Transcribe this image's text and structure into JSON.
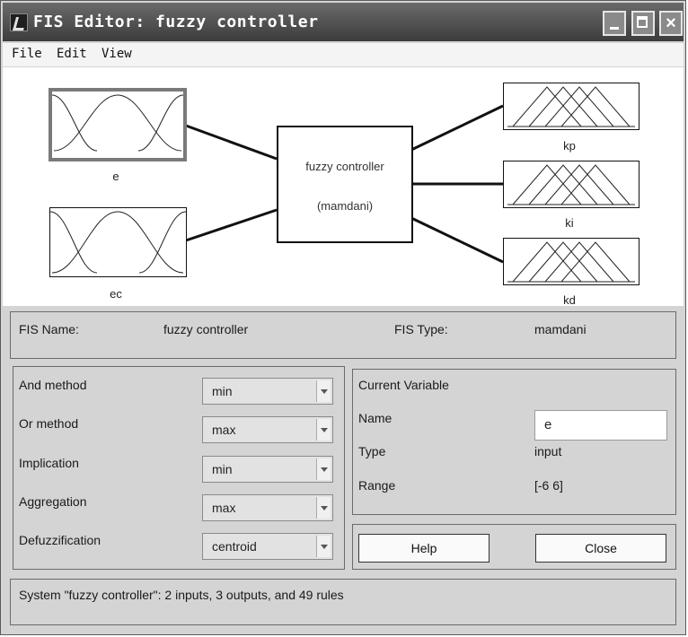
{
  "window": {
    "title": "FIS Editor: fuzzy controller",
    "controls": [
      "minimize-icon",
      "maximize-icon",
      "close-icon"
    ],
    "close_glyph": "×"
  },
  "menu": [
    "File",
    "Edit",
    "View"
  ],
  "diagram": {
    "inputs": [
      "e",
      "ec"
    ],
    "outputs": [
      "kp",
      "ki",
      "kd"
    ],
    "fis_name": "fuzzy controller",
    "fis_type": "(mamdani)",
    "selected_variable": "e"
  },
  "info": {
    "fis_name_label": "FIS Name:",
    "fis_name_value": "fuzzy controller",
    "fis_type_label": "FIS Type:",
    "fis_type_value": "mamdani"
  },
  "methods": [
    {
      "label": "And method",
      "value": "min"
    },
    {
      "label": "Or method",
      "value": "max"
    },
    {
      "label": "Implication",
      "value": "min"
    },
    {
      "label": "Aggregation",
      "value": "max"
    },
    {
      "label": "Defuzzification",
      "value": "centroid"
    }
  ],
  "current_variable": {
    "header": "Current Variable",
    "name_label": "Name",
    "name_value": "e",
    "type_label": "Type",
    "type_value": "input",
    "range_label": "Range",
    "range_value": "[-6 6]"
  },
  "buttons": {
    "help": "Help",
    "close": "Close"
  },
  "status": "System \"fuzzy controller\": 2 inputs, 3 outputs, and 49 rules"
}
